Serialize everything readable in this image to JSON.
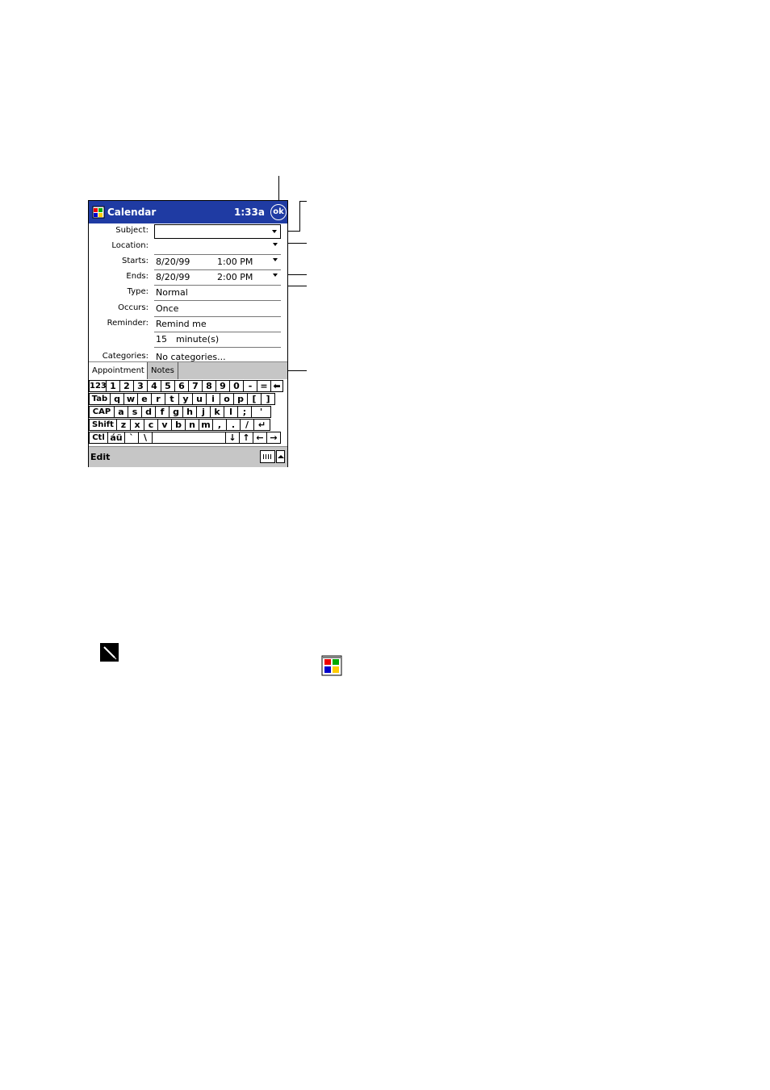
{
  "titlebar": {
    "title": "Calendar",
    "time": "1:33a",
    "ok_label": "ok"
  },
  "form": {
    "subject": {
      "label": "Subject:",
      "value": ""
    },
    "location": {
      "label": "Location:",
      "value": ""
    },
    "starts": {
      "label": "Starts:",
      "date": "8/20/99",
      "time": "1:00 PM"
    },
    "ends": {
      "label": "Ends:",
      "date": "8/20/99",
      "time": "2:00 PM"
    },
    "type": {
      "label": "Type:",
      "value": "Normal"
    },
    "occurs": {
      "label": "Occurs:",
      "value": "Once"
    },
    "reminder": {
      "label": "Reminder:",
      "value": "Remind me",
      "amount": "15",
      "unit": "minute(s)"
    },
    "categories": {
      "label": "Categories:",
      "value": "No categories..."
    }
  },
  "tabs": [
    "Appointment",
    "Notes"
  ],
  "keyboard": {
    "row1": [
      "123",
      "1",
      "2",
      "3",
      "4",
      "5",
      "6",
      "7",
      "8",
      "9",
      "0",
      "-",
      "=",
      "⬅"
    ],
    "row2": [
      "Tab",
      "q",
      "w",
      "e",
      "r",
      "t",
      "y",
      "u",
      "i",
      "o",
      "p",
      "[",
      "]"
    ],
    "row3": [
      "CAP",
      "a",
      "s",
      "d",
      "f",
      "g",
      "h",
      "j",
      "k",
      "l",
      ";",
      "'"
    ],
    "row4": [
      "Shift",
      "z",
      "x",
      "c",
      "v",
      "b",
      "n",
      "m",
      ",",
      ".",
      "/",
      "↵"
    ],
    "row5": [
      "Ctl",
      "áü",
      "`",
      "\\",
      "",
      "↓",
      "↑",
      "←",
      "→"
    ]
  },
  "menubar": {
    "edit_label": "Edit"
  },
  "icons": {
    "app": "calendar-flag-icon",
    "stylus": "stylus-icon",
    "calendar": "calendar-icon"
  }
}
